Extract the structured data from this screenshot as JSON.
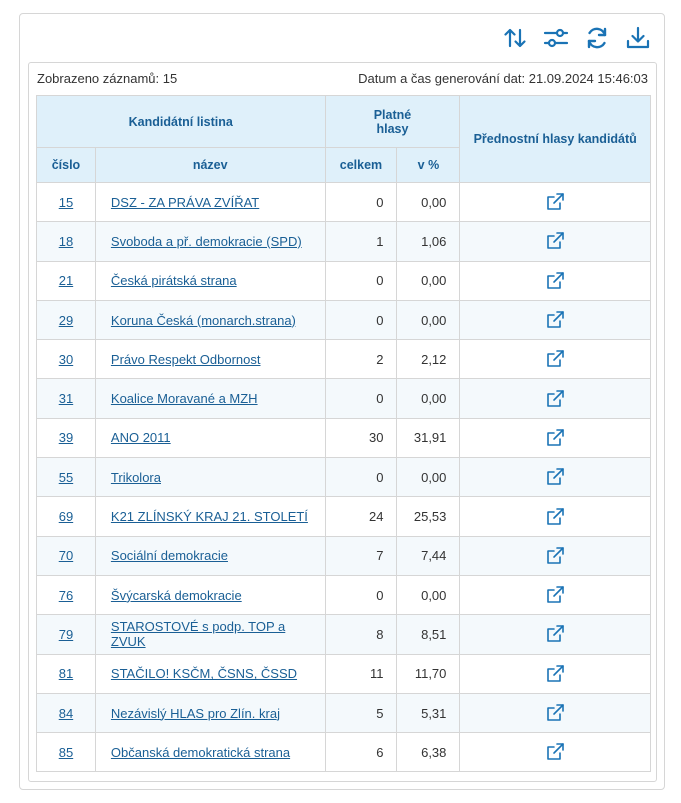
{
  "header": {
    "records_shown": "Zobrazeno záznamů: 15",
    "generated": "Datum a čas generování dat: 21.09.2024 15:46:03"
  },
  "toolbar": {
    "icons": [
      "sort-icon",
      "filter-sliders-icon",
      "refresh-icon",
      "download-icon"
    ]
  },
  "table": {
    "group_header": "Kandidátní listina",
    "votes_header_line1": "Platné",
    "votes_header_line2": "hlasy",
    "pref_header": "Přednostní hlasy kandidátů",
    "col_number": "číslo",
    "col_name": "název",
    "col_total": "celkem",
    "col_percent": "v %",
    "rows": [
      {
        "num": "15",
        "name": "DSZ - ZA PRÁVA ZVÍŘAT",
        "total": "0",
        "pct": "0,00"
      },
      {
        "num": "18",
        "name": "Svoboda a př. demokracie (SPD)",
        "total": "1",
        "pct": "1,06"
      },
      {
        "num": "21",
        "name": "Česká pirátská strana",
        "total": "0",
        "pct": "0,00"
      },
      {
        "num": "29",
        "name": "Koruna Česká (monarch.strana)",
        "total": "0",
        "pct": "0,00"
      },
      {
        "num": "30",
        "name": "Právo Respekt Odbornost",
        "total": "2",
        "pct": "2,12"
      },
      {
        "num": "31",
        "name": "Koalice Moravané a MZH",
        "total": "0",
        "pct": "0,00"
      },
      {
        "num": "39",
        "name": "ANO 2011",
        "total": "30",
        "pct": "31,91"
      },
      {
        "num": "55",
        "name": "Trikolora",
        "total": "0",
        "pct": "0,00"
      },
      {
        "num": "69",
        "name": "K21 ZLÍNSKÝ KRAJ 21. STOLETÍ",
        "total": "24",
        "pct": "25,53"
      },
      {
        "num": "70",
        "name": "Sociální demokracie",
        "total": "7",
        "pct": "7,44"
      },
      {
        "num": "76",
        "name": "Švýcarská demokracie",
        "total": "0",
        "pct": "0,00"
      },
      {
        "num": "79",
        "name": "STAROSTOVÉ s podp. TOP a ZVUK",
        "total": "8",
        "pct": "8,51"
      },
      {
        "num": "81",
        "name": "STAČILO! KSČM, ČSNS, ČSSD",
        "total": "11",
        "pct": "11,70"
      },
      {
        "num": "84",
        "name": "Nezávislý HLAS pro Zlín. kraj",
        "total": "5",
        "pct": "5,31"
      },
      {
        "num": "85",
        "name": "Občanská demokratická strana",
        "total": "6",
        "pct": "6,38"
      }
    ]
  }
}
